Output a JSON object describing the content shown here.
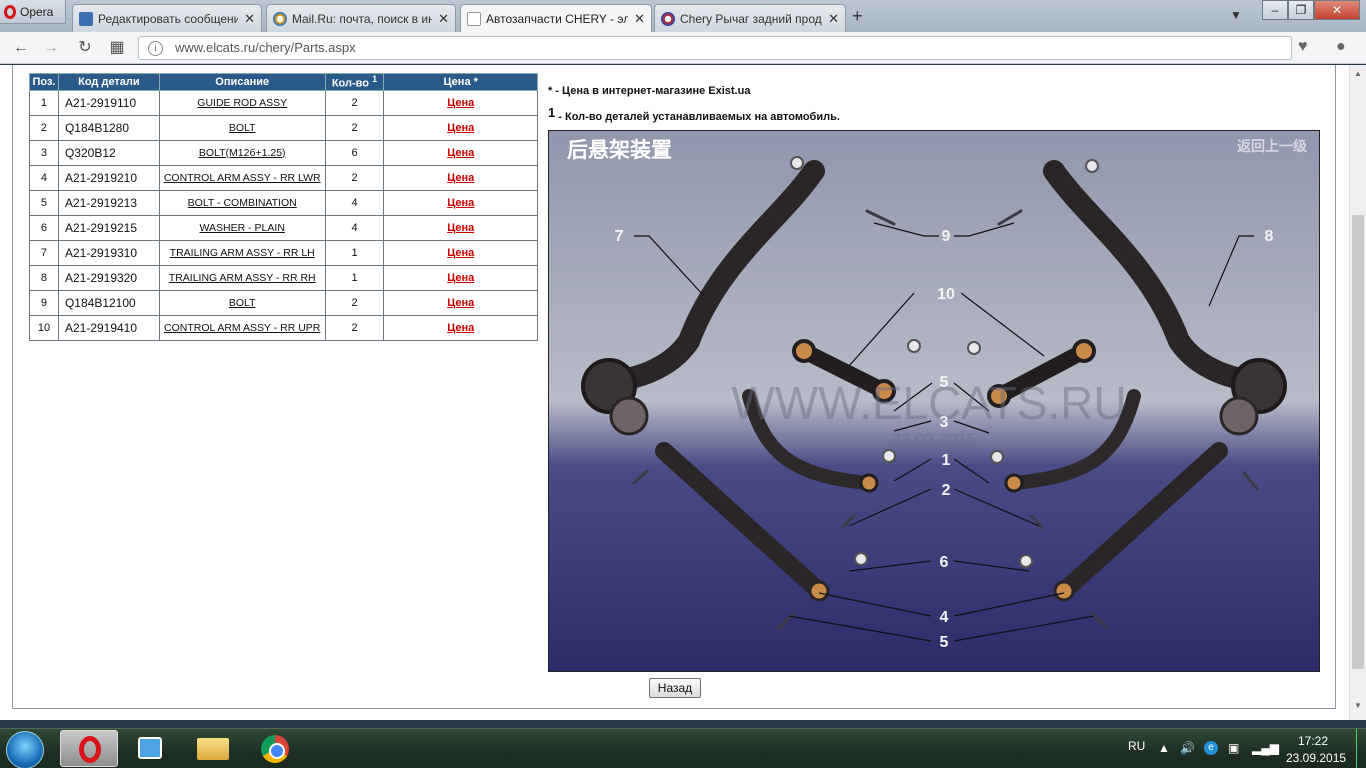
{
  "browser": {
    "menu_label": "Opera",
    "tabs": [
      {
        "label": "Редактировать сообщение",
        "active": false
      },
      {
        "label": "Mail.Ru: почта, поиск в ин",
        "active": false
      },
      {
        "label": "Автозапчасти CHERY - эл",
        "active": true
      },
      {
        "label": "Chery Рычаг задний прод",
        "active": false
      }
    ],
    "tab_close_glyph": "✕",
    "new_tab_glyph": "+",
    "url_host": "www.elcats.ru",
    "url_path": "/chery/Parts.aspx"
  },
  "table": {
    "headers": [
      "Поз.",
      "Код детали",
      "Описание",
      "Кол-во",
      "Цена *"
    ],
    "qty_superscript": "1",
    "rows": [
      {
        "pos": "1",
        "code": "A21-2919110",
        "desc": "GUIDE ROD ASSY",
        "qty": "2",
        "price": "Цена"
      },
      {
        "pos": "2",
        "code": "Q184B1280",
        "desc": "BOLT",
        "qty": "2",
        "price": "Цена"
      },
      {
        "pos": "3",
        "code": "Q320B12",
        "desc": "BOLT(M12б+1.25)",
        "qty": "6",
        "price": "Цена"
      },
      {
        "pos": "4",
        "code": "A21-2919210",
        "desc": "CONTROL ARM ASSY - RR LWR",
        "qty": "2",
        "price": "Цена"
      },
      {
        "pos": "5",
        "code": "A21-2919213",
        "desc": "BOLT - COMBINATION",
        "qty": "4",
        "price": "Цена"
      },
      {
        "pos": "6",
        "code": "A21-2919215",
        "desc": "WASHER - PLAIN",
        "qty": "4",
        "price": "Цена"
      },
      {
        "pos": "7",
        "code": "A21-2919310",
        "desc": "TRAILING ARM ASSY - RR LH",
        "qty": "1",
        "price": "Цена"
      },
      {
        "pos": "8",
        "code": "A21-2919320",
        "desc": "TRAILING ARM ASSY - RR RH",
        "qty": "1",
        "price": "Цена"
      },
      {
        "pos": "9",
        "code": "Q184B12100",
        "desc": "BOLT",
        "qty": "2",
        "price": "Цена"
      },
      {
        "pos": "10",
        "code": "A21-2919410",
        "desc": "CONTROL ARM ASSY - RR UPR",
        "qty": "2",
        "price": "Цена"
      }
    ]
  },
  "notes": {
    "star_mark": "*",
    "star_text": " - Цена в интернет-магазине Exist.ua",
    "one_mark": "1",
    "one_text": " - Кол-во деталей устанавливаемых на автомобиль."
  },
  "diagram": {
    "title": "后悬架装置",
    "back_link": "返回上一级",
    "watermark": "WWW.ELCATS.RU",
    "date": "23.09.2015",
    "callouts": [
      "7",
      "9",
      "8",
      "10",
      "5",
      "3",
      "1",
      "2",
      "6",
      "4",
      "5"
    ]
  },
  "back_button": "Назад",
  "taskbar": {
    "lang": "RU",
    "time": "17:22",
    "date": "23.09.2015"
  },
  "colors": {
    "table_header_bg": "#295a8a",
    "price_link": "#cc0000",
    "diagram_top": "#8a8fa6",
    "diagram_bottom": "#2e2f6a"
  }
}
